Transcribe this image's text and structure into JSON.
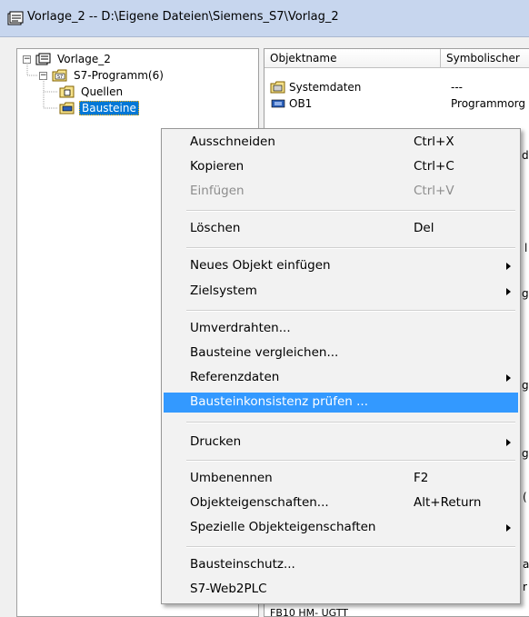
{
  "window": {
    "title": "Vorlage_2 -- D:\\Eigene Dateien\\Siemens_S7\\Vorlag_2",
    "icon": "project-icon"
  },
  "tree": {
    "root": {
      "label": "Vorlage_2",
      "expander": "−",
      "icon": "project-icon"
    },
    "program": {
      "label": "S7-Programm(6)",
      "expander": "−",
      "icon": "s7-program-icon"
    },
    "sources": {
      "label": "Quellen",
      "icon": "folder-icon"
    },
    "blocks": {
      "label": "Bausteine",
      "icon": "blocks-folder-icon",
      "selected": true
    }
  },
  "list": {
    "columns": [
      "Objektname",
      "Symbolischer"
    ],
    "rows": [
      {
        "name": "Systemdaten",
        "symbol": "---",
        "icon": "system-data-icon"
      },
      {
        "name": "OB1",
        "symbol": "Programmorg",
        "icon": "block-icon"
      }
    ],
    "partial_text": [
      {
        "id": "frag-d",
        "text": "d"
      },
      {
        "id": "frag-l",
        "text": "l"
      },
      {
        "id": "frag-g1",
        "text": "g"
      },
      {
        "id": "frag-g2",
        "text": "g"
      },
      {
        "id": "frag-g3",
        "text": "g"
      },
      {
        "id": "frag-paren",
        "text": "("
      },
      {
        "id": "frag-a",
        "text": "a"
      },
      {
        "id": "frag-r",
        "text": "r"
      },
      {
        "id": "frag-bottom",
        "text": "FB10      HM- UGTT"
      }
    ]
  },
  "context_menu": {
    "items": [
      {
        "label": "Ausschneiden",
        "shortcut": "Ctrl+X"
      },
      {
        "label": "Kopieren",
        "shortcut": "Ctrl+C"
      },
      {
        "label": "Einfügen",
        "shortcut": "Ctrl+V",
        "disabled": true
      },
      {
        "label": "Löschen",
        "shortcut": "Del"
      },
      {
        "label": "Neues Objekt einfügen",
        "submenu": true
      },
      {
        "label": "Zielsystem",
        "submenu": true
      },
      {
        "label": "Umverdrahten..."
      },
      {
        "label": "Bausteine vergleichen..."
      },
      {
        "label": "Referenzdaten",
        "submenu": true
      },
      {
        "label": "Bausteinkonsistenz prüfen ...",
        "highlighted": true
      },
      {
        "label": "Drucken",
        "submenu": true
      },
      {
        "label": "Umbenennen",
        "shortcut": "F2"
      },
      {
        "label": "Objekteigenschaften...",
        "shortcut": "Alt+Return"
      },
      {
        "label": "Spezielle Objekteigenschaften",
        "submenu": true
      },
      {
        "label": "Bausteinschutz..."
      },
      {
        "label": "S7-Web2PLC"
      }
    ]
  },
  "colors": {
    "highlight": "#3399ff",
    "selection": "#0078d7",
    "titlebar": "#c7d6ee"
  }
}
